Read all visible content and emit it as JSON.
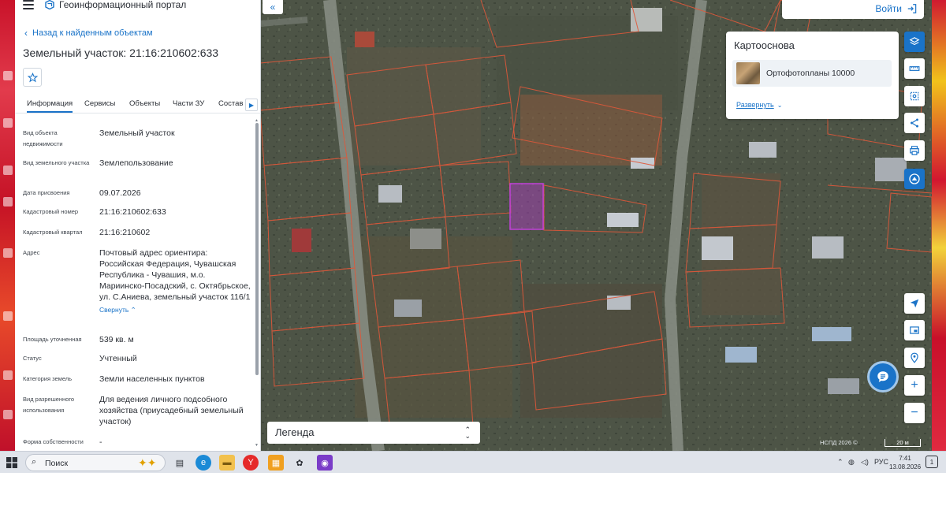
{
  "app": {
    "title": "Геоинформационный портал"
  },
  "panel": {
    "back_link": "Назад к найденным объектам",
    "page_title": "Земельный участок: 21:16:210602:633",
    "tabs": [
      "Информация",
      "Сервисы",
      "Объекты",
      "Части ЗУ",
      "Состав"
    ],
    "collapse_label": "Свернуть",
    "fields": [
      {
        "label": "Вид объекта недвижимости",
        "value": "Земельный участок"
      },
      {
        "label": "Вид земельного участка",
        "value": "Землепользование"
      },
      {
        "label": "Дата присвоения",
        "value": "09.07.2026"
      },
      {
        "label": "Кадастровый номер",
        "value": "21:16:210602:633"
      },
      {
        "label": "Кадастровый квартал",
        "value": "21:16:210602"
      },
      {
        "label": "Адрес",
        "value": "Почтовый адрес ориентира: Российская Федерация, Чувашская Республика - Чувашия, м.о. Мариинско-Посадский, с. Октябрьское, ул. С.Аниева, земельный участок 116/1"
      },
      {
        "label": "Площадь уточненная",
        "value": "539 кв. м"
      },
      {
        "label": "Статус",
        "value": "Учтенный"
      },
      {
        "label": "Категория земель",
        "value": "Земли населенных пунктов"
      },
      {
        "label": "Вид разрешенного использования",
        "value": "Для ведения личного подсобного хозяйства (приусадебный земельный участок)"
      },
      {
        "label": "Форма собственности",
        "value": "-"
      }
    ]
  },
  "map": {
    "login_label": "Войти",
    "basemap": {
      "title": "Картооснова",
      "item": "Ортофотопланы 10000",
      "expand_label": "Развернуть"
    },
    "legend_label": "Легенда",
    "attribution": "НСПД 2026 ©",
    "scale_label": "20 м",
    "colors": {
      "parcel_border": "#e0583a",
      "selected_parcel": "#b23cc8",
      "accent": "#1a73c8"
    },
    "tools": [
      "layers-icon",
      "ruler-icon",
      "select-area-icon",
      "share-icon",
      "print-icon",
      "assistant-icon",
      "locate-icon",
      "minimap-icon",
      "location-pin-icon",
      "zoom-in-icon",
      "zoom-out-icon"
    ]
  },
  "taskbar": {
    "search_placeholder": "Поиск",
    "language": "РУС",
    "time": "7:41",
    "date": "13.08.2026",
    "notification_count": "1"
  }
}
